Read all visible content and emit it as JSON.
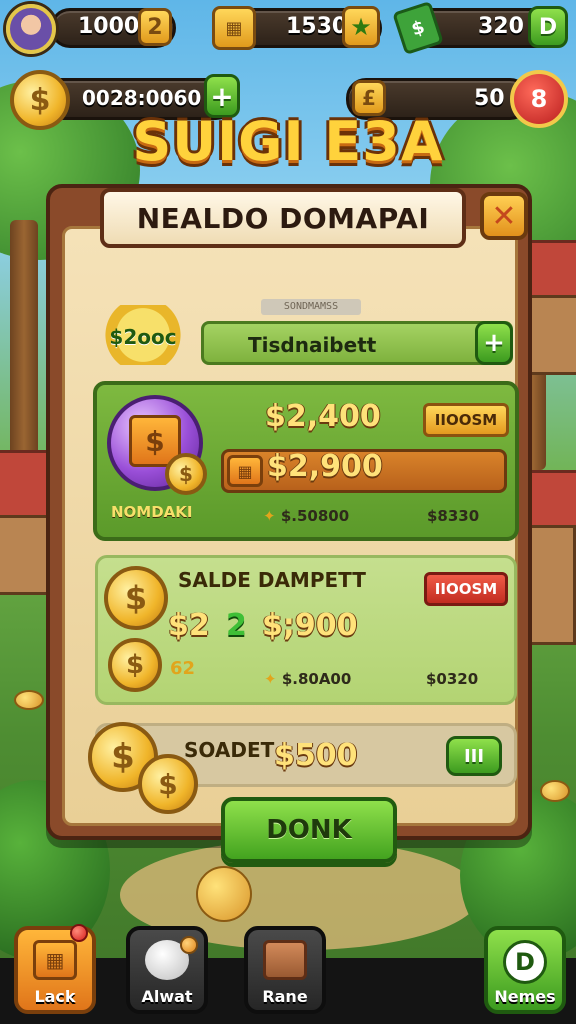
{
  "hud": {
    "stat_1": "1000",
    "stat_1_icon": "2",
    "stat_2": "1530",
    "stat_3": "320",
    "stat_3_button": "D",
    "coins_total": "0028:0060",
    "coins_add": "+",
    "energy_value": "50",
    "energy_icon_text": "8",
    "gem_icon_text": "£"
  },
  "game_title": "SUIGI E3A",
  "modal": {
    "title": "NEALDO DOMAPAI",
    "close": "✕",
    "subtitle": "SONDMAMSS",
    "badge": "$2ooc",
    "field": {
      "value": "Tisdnaibett",
      "plus": "+"
    },
    "offers": [
      {
        "label": "NOMDAKI",
        "price_primary": "$2,400",
        "price_highlight": "$2,900",
        "button": "IIOOSM",
        "chest_icon": "$",
        "meta_left": "$.50800",
        "meta_right": "$8330"
      },
      {
        "title": "SALDE DAMPETT",
        "multiplier_1": "$2",
        "multiplier_2": "2",
        "price": "$;900",
        "small_coin_label": "62",
        "button": "IIOOSM",
        "meta_left": "$.80A00",
        "meta_right": "$0320"
      },
      {
        "title": "SOADET",
        "price": "$500",
        "button_icon": "III"
      }
    ],
    "confirm": "DONK"
  },
  "bottom_nav": [
    {
      "label": "Lack"
    },
    {
      "label": "Alwat"
    },
    {
      "label": "Rane"
    },
    {
      "label": "Nemes",
      "icon_text": "D"
    }
  ],
  "colors": {
    "accent_gold": "#ffd23c",
    "button_green": "#43a31f",
    "button_red": "#c22c20",
    "modal_frame": "#8a4a2a"
  }
}
